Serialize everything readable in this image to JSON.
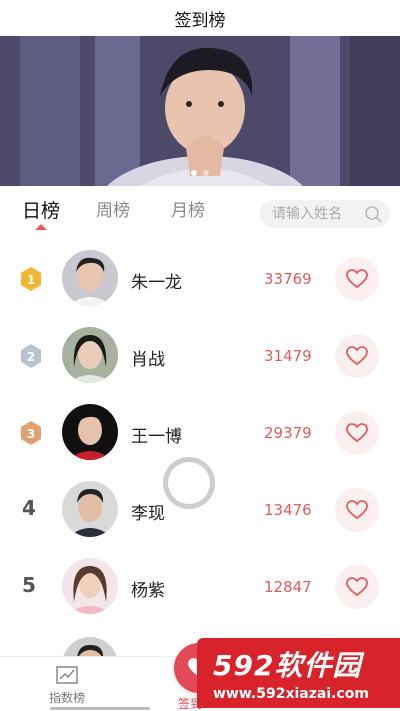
{
  "header": {
    "title": "签到榜"
  },
  "banner": {
    "slides": 2,
    "active_slide": 1
  },
  "tabs": [
    {
      "label": "日榜",
      "active": true
    },
    {
      "label": "周榜",
      "active": false
    },
    {
      "label": "月榜",
      "active": false
    }
  ],
  "search": {
    "placeholder": "请输入姓名",
    "value": ""
  },
  "ranking": [
    {
      "rank": "1",
      "badge": "gold",
      "name": "朱一龙",
      "score": "33769"
    },
    {
      "rank": "2",
      "badge": "silver",
      "name": "肖战",
      "score": "31479"
    },
    {
      "rank": "3",
      "badge": "bronze",
      "name": "王一博",
      "score": "29379"
    },
    {
      "rank": "4",
      "badge": "none",
      "name": "李现",
      "score": "13476"
    },
    {
      "rank": "5",
      "badge": "none",
      "name": "杨紫",
      "score": "12847"
    }
  ],
  "bottom_nav": {
    "items": [
      {
        "label": "指数榜",
        "icon": "chart-icon"
      },
      {
        "label": "签到",
        "icon": "heart-icon"
      }
    ]
  },
  "watermark": {
    "title": "592软件园",
    "subtitle": "www.592xiazai.com"
  },
  "colors": {
    "accent": "#e25c5c",
    "brand_red": "#d8232a",
    "gold": "#f2b630",
    "silver": "#b9c2cf",
    "bronze": "#e2a071"
  }
}
